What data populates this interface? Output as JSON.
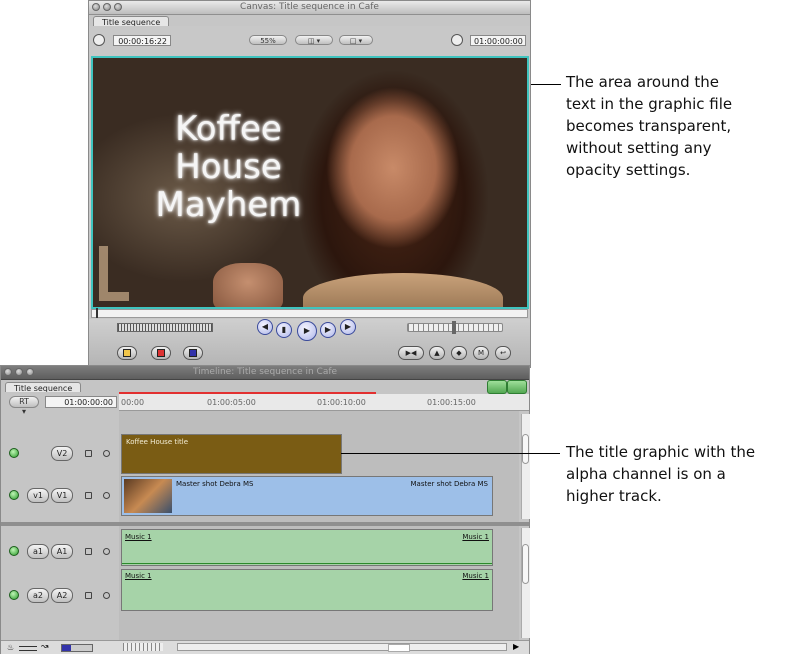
{
  "canvas": {
    "window_title": "Canvas: Title sequence in Cafe",
    "tab": "Title sequence",
    "timecode_left": "00:00:16:22",
    "zoom": "55%",
    "timecode_right": "01:00:00:00",
    "title_overlay": [
      "Koffee",
      "House",
      "Mayhem"
    ]
  },
  "timeline": {
    "window_title": "Timeline: Title sequence in Cafe",
    "tab": "Title sequence",
    "rt_button": "RT",
    "timecode": "01:00:00:00",
    "ruler": [
      "00:00",
      "01:00:05:00",
      "01:00:10:00",
      "01:00:15:00"
    ],
    "tracks": {
      "v2": {
        "dest": "V2"
      },
      "v1": {
        "src": "v1",
        "dest": "V1"
      },
      "a1": {
        "src": "a1",
        "dest": "A1"
      },
      "a2": {
        "src": "a2",
        "dest": "A2"
      }
    },
    "clips": {
      "title": "Koffee House title",
      "master_left": "Master shot Debra MS",
      "master_right": "Master shot Debra MS",
      "music_a1_left": "Music 1",
      "music_a1_right": "Music 1",
      "music_a2_left": "Music 1",
      "music_a2_right": "Music 1"
    }
  },
  "callouts": {
    "top": [
      "The area around the",
      "text in the graphic file",
      "becomes transparent,",
      "without setting any",
      "opacity settings."
    ],
    "bottom": [
      "The title graphic with the",
      "alpha channel is on a",
      "higher track."
    ]
  },
  "colors": {
    "viewer_border": "#3fc4bf",
    "title_clip": "#7a5c14",
    "video_clip": "#9dbfe8",
    "audio_clip": "#a6d3a8",
    "playhead": "#e23030"
  }
}
